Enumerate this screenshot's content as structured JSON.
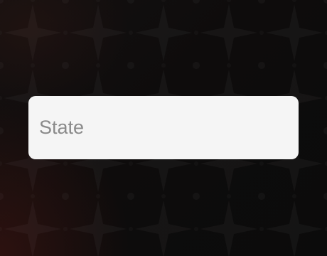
{
  "form": {
    "state_field": {
      "value": "",
      "placeholder": "State"
    }
  },
  "colors": {
    "background": "#0f0d0d",
    "field_background": "#f5f5f5",
    "placeholder_text": "#8a8a8a"
  }
}
